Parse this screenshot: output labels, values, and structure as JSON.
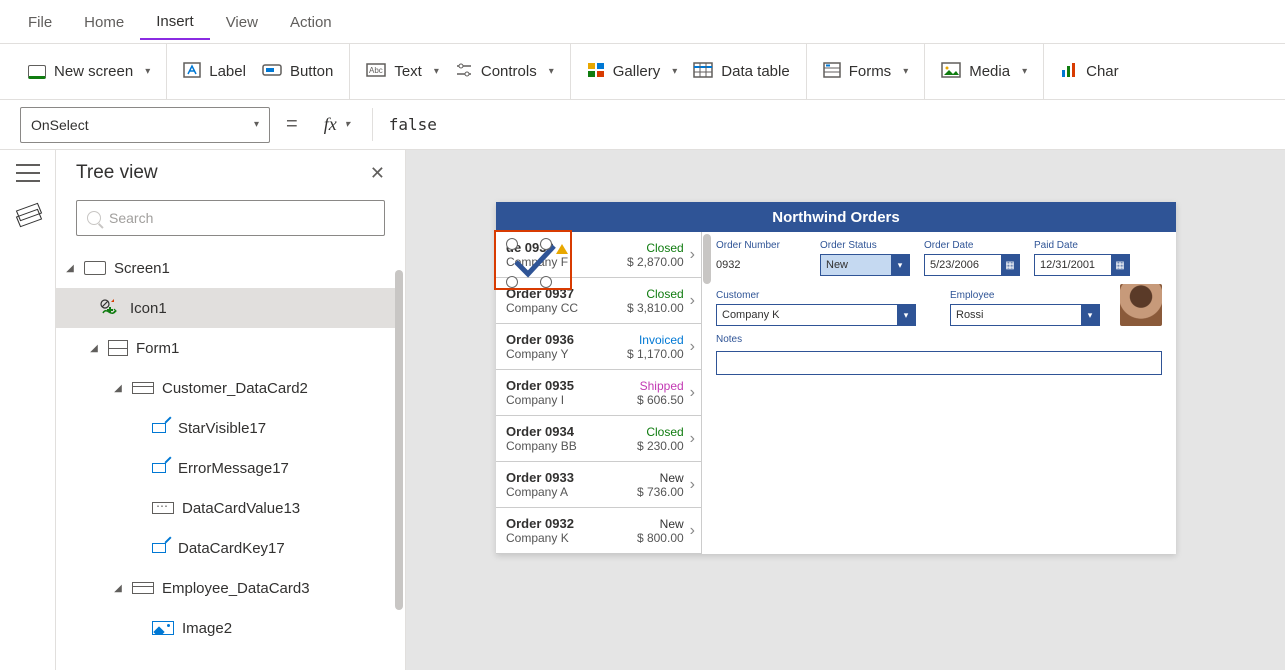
{
  "menu": {
    "file": "File",
    "home": "Home",
    "insert": "Insert",
    "view": "View",
    "action": "Action"
  },
  "ribbon": {
    "new_screen": "New screen",
    "label": "Label",
    "button": "Button",
    "text": "Text",
    "controls": "Controls",
    "gallery": "Gallery",
    "data_table": "Data table",
    "forms": "Forms",
    "media": "Media",
    "chart": "Char"
  },
  "formula": {
    "property": "OnSelect",
    "fx": "fx",
    "value": "false"
  },
  "tree": {
    "title": "Tree view",
    "search_placeholder": "Search",
    "nodes": {
      "screen1": "Screen1",
      "icon1": "Icon1",
      "form1": "Form1",
      "customer_card": "Customer_DataCard2",
      "starvisible": "StarVisible17",
      "errormessage": "ErrorMessage17",
      "datacardvalue": "DataCardValue13",
      "datacardkey": "DataCardKey17",
      "employee_card": "Employee_DataCard3",
      "image2": "Image2"
    }
  },
  "app": {
    "title": "Northwind Orders",
    "orders": [
      {
        "title": "    de   0938",
        "sub": "Company F",
        "status": "Closed",
        "status_cls": "st-closed",
        "amt": "$ 2,870.00",
        "warn": true
      },
      {
        "title": "Order 0937",
        "sub": "Company CC",
        "status": "Closed",
        "status_cls": "st-closed",
        "amt": "$ 3,810.00"
      },
      {
        "title": "Order 0936",
        "sub": "Company Y",
        "status": "Invoiced",
        "status_cls": "st-invoiced",
        "amt": "$ 1,170.00"
      },
      {
        "title": "Order 0935",
        "sub": "Company I",
        "status": "Shipped",
        "status_cls": "st-shipped",
        "amt": "$ 606.50"
      },
      {
        "title": "Order 0934",
        "sub": "Company BB",
        "status": "Closed",
        "status_cls": "st-closed",
        "amt": "$ 230.00"
      },
      {
        "title": "Order 0933",
        "sub": "Company A",
        "status": "New",
        "status_cls": "st-new",
        "amt": "$ 736.00"
      },
      {
        "title": "Order 0932",
        "sub": "Company K",
        "status": "New",
        "status_cls": "st-new",
        "amt": "$ 800.00"
      }
    ],
    "form": {
      "order_number_label": "Order Number",
      "order_number": "0932",
      "order_status_label": "Order Status",
      "order_status": "New",
      "order_date_label": "Order Date",
      "order_date": "5/23/2006",
      "paid_date_label": "Paid Date",
      "paid_date": "12/31/2001",
      "customer_label": "Customer",
      "customer": "Company K",
      "employee_label": "Employee",
      "employee": "Rossi",
      "notes_label": "Notes"
    }
  }
}
